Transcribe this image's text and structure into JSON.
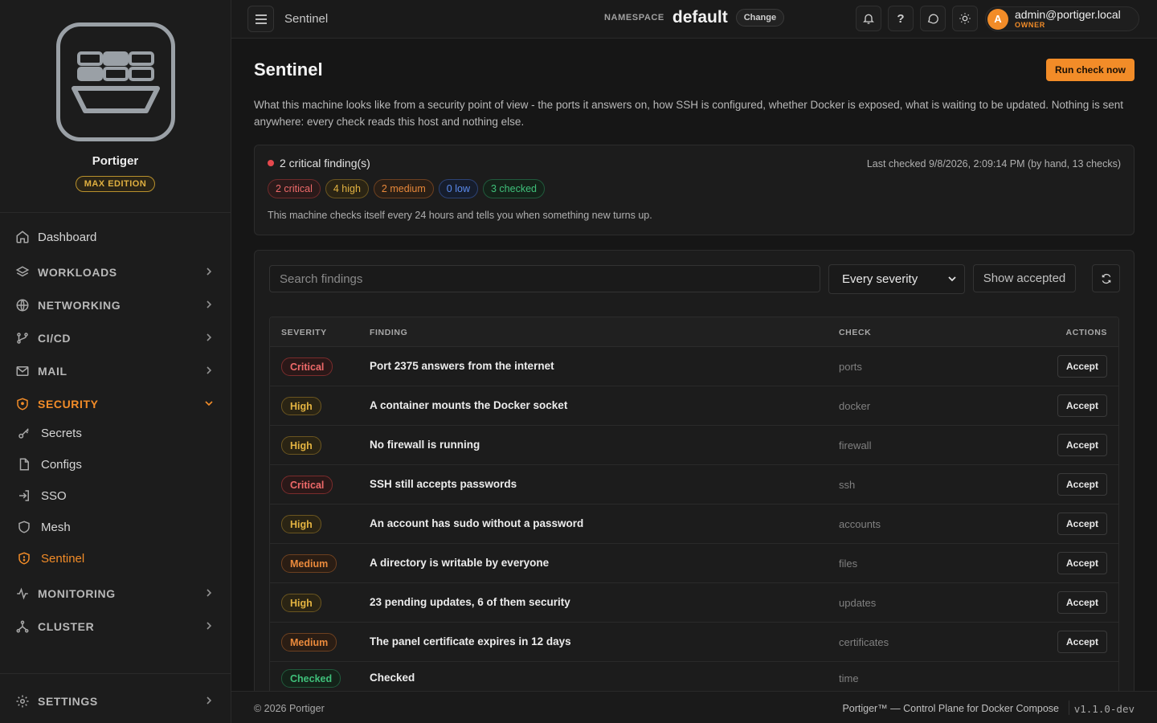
{
  "brand": {
    "name": "Portiger",
    "edition": "MAX EDITION"
  },
  "sidebar": {
    "items": [
      {
        "label": "Dashboard",
        "icon": "home-icon"
      },
      {
        "label": "WORKLOADS",
        "icon": "layers-icon"
      },
      {
        "label": "NETWORKING",
        "icon": "globe-icon"
      },
      {
        "label": "CI/CD",
        "icon": "git-branch-icon"
      },
      {
        "label": "MAIL",
        "icon": "mail-icon"
      },
      {
        "label": "SECURITY",
        "icon": "shield-icon"
      },
      {
        "label": "Secrets",
        "icon": "key-icon"
      },
      {
        "label": "Configs",
        "icon": "file-icon"
      },
      {
        "label": "SSO",
        "icon": "login-icon"
      },
      {
        "label": "Mesh",
        "icon": "shield-icon"
      },
      {
        "label": "Sentinel",
        "icon": "shield-alert-icon"
      },
      {
        "label": "MONITORING",
        "icon": "pulse-icon"
      },
      {
        "label": "CLUSTER",
        "icon": "cluster-icon"
      }
    ],
    "settings_label": "SETTINGS",
    "active_item": "Sentinel"
  },
  "topbar": {
    "title": "Sentinel",
    "namespace_label": "NAMESPACE",
    "namespace_value": "default",
    "change_label": "Change",
    "help_glyph": "?",
    "user_initial": "A",
    "user_email": "admin@portiger.local",
    "user_role": "OWNER"
  },
  "page": {
    "title": "Sentinel",
    "run_button": "Run check now",
    "description": "What this machine looks like from a security point of view - the ports it answers on, how SSH is configured, whether Docker is exposed, what is waiting to be updated. Nothing is sent anywhere: every check reads this host and nothing else."
  },
  "summary": {
    "headline": "2 critical finding(s)",
    "last_checked": "Last checked 9/8/2026, 2:09:14 PM (by hand, 13 checks)",
    "pills": {
      "critical": "2 critical",
      "high": "4 high",
      "medium": "2 medium",
      "low": "0 low",
      "checked": "3 checked"
    },
    "note": "This machine checks itself every 24 hours and tells you when something new turns up."
  },
  "filters": {
    "search_placeholder": "Search findings",
    "severity_selected": "Every severity",
    "show_accepted": "Show accepted"
  },
  "table": {
    "headers": {
      "severity": "SEVERITY",
      "finding": "FINDING",
      "check": "CHECK",
      "actions": "ACTIONS"
    },
    "accept_label": "Accept",
    "rows": [
      {
        "severity": "Critical",
        "finding": "Port 2375 answers from the internet",
        "check": "ports"
      },
      {
        "severity": "High",
        "finding": "A container mounts the Docker socket",
        "check": "docker"
      },
      {
        "severity": "High",
        "finding": "No firewall is running",
        "check": "firewall"
      },
      {
        "severity": "Critical",
        "finding": "SSH still accepts passwords",
        "check": "ssh"
      },
      {
        "severity": "High",
        "finding": "An account has sudo without a password",
        "check": "accounts"
      },
      {
        "severity": "Medium",
        "finding": "A directory is writable by everyone",
        "check": "files"
      },
      {
        "severity": "High",
        "finding": "23 pending updates, 6 of them security",
        "check": "updates"
      },
      {
        "severity": "Medium",
        "finding": "The panel certificate expires in 12 days",
        "check": "certificates"
      },
      {
        "severity": "Checked",
        "finding": "Checked",
        "check": "time"
      }
    ]
  },
  "footer": {
    "copyright": "© 2026 Portiger",
    "tagline": "Portiger™ — Control Plane for Docker Compose",
    "version": "v1.1.0-dev"
  },
  "colors": {
    "accent": "#f28c28",
    "critical": "#ef6a6a",
    "high": "#e3b341",
    "medium": "#ea8a3c",
    "low": "#5b8cf0",
    "checked": "#3fc07a"
  }
}
